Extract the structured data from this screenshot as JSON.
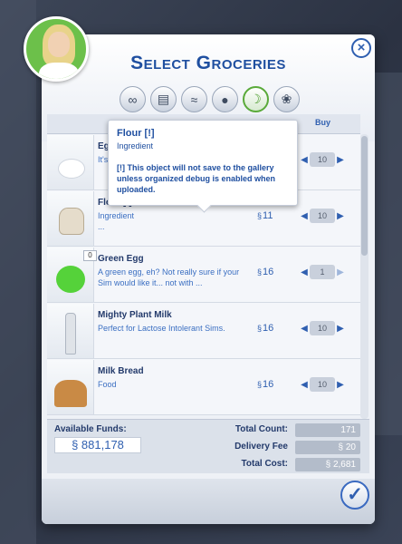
{
  "dialog": {
    "title": "Select Groceries",
    "close_label": "×",
    "confirm_label": "✓"
  },
  "filters": [
    {
      "icon": "infinity-icon",
      "glyph": "∞",
      "active": false
    },
    {
      "icon": "book-icon",
      "glyph": "▤",
      "active": false
    },
    {
      "icon": "fish-icon",
      "glyph": "≈",
      "active": false
    },
    {
      "icon": "apple-icon",
      "glyph": "●",
      "active": false
    },
    {
      "icon": "leaf-icon",
      "glyph": "☽",
      "active": true
    },
    {
      "icon": "carrot-icon",
      "glyph": "❀",
      "active": false
    }
  ],
  "columns": {
    "buy": "Buy"
  },
  "items": [
    {
      "name": "Eg",
      "desc": "It's",
      "price": "",
      "qty": "10"
    },
    {
      "name": "Flour [!]",
      "desc": "Ingredient\n...",
      "price": "11",
      "qty": "10"
    },
    {
      "name": "Green Egg",
      "desc": "A green egg, eh? Not really sure if your Sim would like it... not with ...",
      "price": "16",
      "qty": "1",
      "count_badge": "0"
    },
    {
      "name": "Mighty Plant Milk",
      "desc": "Perfect for Lactose Intolerant Sims.",
      "price": "16",
      "qty": "10"
    },
    {
      "name": "Milk Bread",
      "desc": "Food",
      "price": "16",
      "qty": "10"
    }
  ],
  "currency": "§",
  "footer": {
    "funds_label": "Available Funds:",
    "funds_value": "881,178",
    "total_count_label": "Total Count:",
    "total_count_value": "171",
    "delivery_fee_label": "Delivery Fee",
    "delivery_fee_value": "20",
    "total_cost_label": "Total Cost:",
    "total_cost_value": "2,681"
  },
  "tooltip": {
    "title": "Flour [!]",
    "subtitle": "Ingredient",
    "body": "[!] This object will not save to the gallery unless organized debug is enabled when uploaded."
  }
}
